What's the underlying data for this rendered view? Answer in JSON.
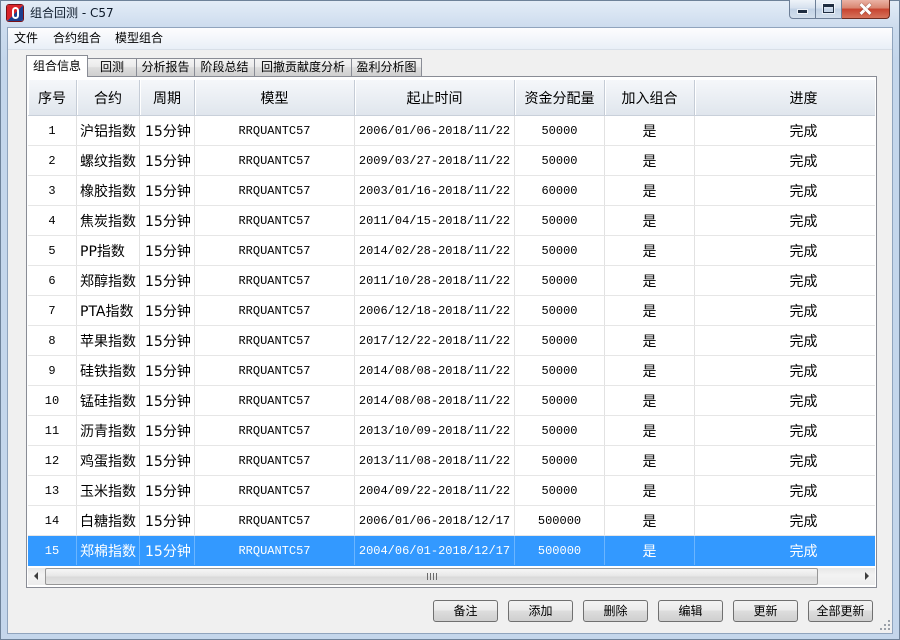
{
  "window": {
    "title": "组合回测 - C57",
    "icon": "app-icon",
    "controls": [
      "minimize-icon",
      "maximize-icon",
      "close-icon"
    ]
  },
  "menu": {
    "items": [
      "文件",
      "合约组合",
      "模型组合"
    ]
  },
  "tabs": [
    {
      "label": "组合信息",
      "active": true
    },
    {
      "label": "回测",
      "active": false
    },
    {
      "label": "分析报告",
      "active": false
    },
    {
      "label": "阶段总结",
      "active": false
    },
    {
      "label": "回撤贡献度分析",
      "active": false
    },
    {
      "label": "盈利分析图",
      "active": false
    }
  ],
  "table": {
    "columns": [
      "序号",
      "合约",
      "周期",
      "模型",
      "起止时间",
      "资金分配量",
      "加入组合",
      "进度"
    ],
    "rows": [
      {
        "cells": [
          "1",
          "沪铝指数",
          "15分钟",
          "RRQUANTC57",
          "2006/01/06-2018/11/22",
          "50000",
          "是",
          "完成"
        ]
      },
      {
        "cells": [
          "2",
          "螺纹指数",
          "15分钟",
          "RRQUANTC57",
          "2009/03/27-2018/11/22",
          "50000",
          "是",
          "完成"
        ]
      },
      {
        "cells": [
          "3",
          "橡胶指数",
          "15分钟",
          "RRQUANTC57",
          "2003/01/16-2018/11/22",
          "60000",
          "是",
          "完成"
        ]
      },
      {
        "cells": [
          "4",
          "焦炭指数",
          "15分钟",
          "RRQUANTC57",
          "2011/04/15-2018/11/22",
          "50000",
          "是",
          "完成"
        ]
      },
      {
        "cells": [
          "5",
          "PP指数",
          "15分钟",
          "RRQUANTC57",
          "2014/02/28-2018/11/22",
          "50000",
          "是",
          "完成"
        ]
      },
      {
        "cells": [
          "6",
          "郑醇指数",
          "15分钟",
          "RRQUANTC57",
          "2011/10/28-2018/11/22",
          "50000",
          "是",
          "完成"
        ]
      },
      {
        "cells": [
          "7",
          "PTA指数",
          "15分钟",
          "RRQUANTC57",
          "2006/12/18-2018/11/22",
          "50000",
          "是",
          "完成"
        ]
      },
      {
        "cells": [
          "8",
          "苹果指数",
          "15分钟",
          "RRQUANTC57",
          "2017/12/22-2018/11/22",
          "50000",
          "是",
          "完成"
        ]
      },
      {
        "cells": [
          "9",
          "硅铁指数",
          "15分钟",
          "RRQUANTC57",
          "2014/08/08-2018/11/22",
          "50000",
          "是",
          "完成"
        ]
      },
      {
        "cells": [
          "10",
          "锰硅指数",
          "15分钟",
          "RRQUANTC57",
          "2014/08/08-2018/11/22",
          "50000",
          "是",
          "完成"
        ]
      },
      {
        "cells": [
          "11",
          "沥青指数",
          "15分钟",
          "RRQUANTC57",
          "2013/10/09-2018/11/22",
          "50000",
          "是",
          "完成"
        ]
      },
      {
        "cells": [
          "12",
          "鸡蛋指数",
          "15分钟",
          "RRQUANTC57",
          "2013/11/08-2018/11/22",
          "50000",
          "是",
          "完成"
        ]
      },
      {
        "cells": [
          "13",
          "玉米指数",
          "15分钟",
          "RRQUANTC57",
          "2004/09/22-2018/11/22",
          "50000",
          "是",
          "完成"
        ]
      },
      {
        "cells": [
          "14",
          "白糖指数",
          "15分钟",
          "RRQUANTC57",
          "2006/01/06-2018/12/17",
          "500000",
          "是",
          "完成"
        ]
      },
      {
        "cells": [
          "15",
          "郑棉指数",
          "15分钟",
          "RRQUANTC57",
          "2004/06/01-2018/12/17",
          "500000",
          "是",
          "完成"
        ],
        "selected": true
      }
    ]
  },
  "scrollbar": {
    "icons": [
      "arrow-left-icon",
      "arrow-right-icon"
    ]
  },
  "buttons": [
    "备注",
    "添加",
    "删除",
    "编辑",
    "更新",
    "全部更新"
  ],
  "colors": {
    "selection": "#3399ff",
    "selection_text": "#ffffff",
    "close_button": "#c7432f"
  }
}
